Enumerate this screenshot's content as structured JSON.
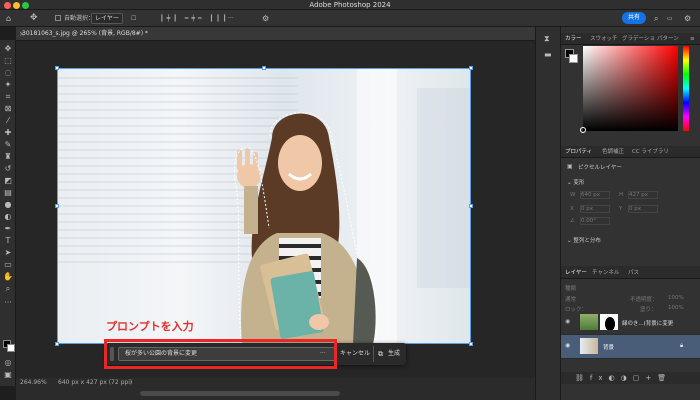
{
  "app": {
    "title": "Adobe Photoshop 2024"
  },
  "options_bar": {
    "auto_select_label": "自動選択：",
    "auto_select_value": "レイヤー",
    "share_label": "共有"
  },
  "document": {
    "tab_label": "30181063_s.jpg @ 265% (背景, RGB/8#) *"
  },
  "annotation": {
    "text": "プロンプトを入力"
  },
  "generative_bar": {
    "prompt_value": "桜が多い公園の背景に変更",
    "more_label": "···",
    "cancel_label": "キャンセル",
    "generate_label": "生成"
  },
  "status": {
    "zoom": "264.96%",
    "doc_size": "640 px x 427 px (72 ppi)"
  },
  "color_panel": {
    "tabs": [
      "カラー",
      "スウォッチ",
      "グラデーショ",
      "パターン"
    ]
  },
  "properties_panel": {
    "tabs": [
      "プロパティ",
      "色調補正",
      "CC ライブラリ"
    ],
    "layer_type": "ピクセルレイヤー",
    "transform_label": "変形",
    "w": "640 px",
    "h": "427 px",
    "x": "0 px",
    "y": "0 px",
    "angle": "0.00°",
    "align_label": "整列と分布"
  },
  "layers_panel": {
    "tabs": [
      "レイヤー",
      "チャンネル",
      "パス"
    ],
    "kind_label": "種類",
    "blend_mode": "通常",
    "opacity_label": "不透明度：",
    "opacity": "100%",
    "lock_label": "ロック：",
    "fill_label": "塗り：",
    "fill": "100%",
    "layers": [
      {
        "name": "緑のき...(背景に変更"
      },
      {
        "name": "背景"
      }
    ]
  },
  "colors": {
    "accent": "#1473e6",
    "annotation": "#e82828",
    "selected_layer": "#4a5d78"
  }
}
